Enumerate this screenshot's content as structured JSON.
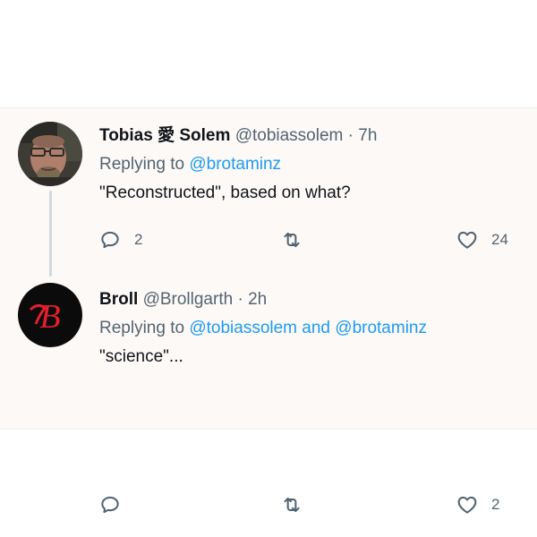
{
  "tweets": [
    {
      "name": "Tobias 愛 Solem",
      "handle": "@tobiassolem",
      "separator": "·",
      "time": "7h",
      "replying_prefix": "Replying to",
      "replying_mentions": [
        "@brotaminz"
      ],
      "replying_joiner": "",
      "text": "\"Reconstructed\", based on what?",
      "reply_count": "2",
      "retweet_count": "",
      "like_count": "24"
    },
    {
      "name": "Broll",
      "handle": "@Brollgarth",
      "separator": "·",
      "time": "2h",
      "replying_prefix": "Replying to",
      "replying_mentions": [
        "@tobiassolem",
        "@brotaminz"
      ],
      "replying_joiner": "and",
      "text": "\"science\"...",
      "reply_count": "",
      "retweet_count": "",
      "like_count": "2"
    }
  ],
  "colors": {
    "background": "#fdf9f7",
    "text": "#0f1419",
    "secondary": "#536471",
    "link": "#1d9bf0",
    "thread_line": "#cfd9de",
    "avatar2_bg": "#0b0b0b",
    "avatar2_logo": "#e0202b"
  },
  "icons": {
    "reply": "speech-bubble-icon",
    "retweet": "retweet-arrows-icon",
    "like": "heart-outline-icon"
  }
}
